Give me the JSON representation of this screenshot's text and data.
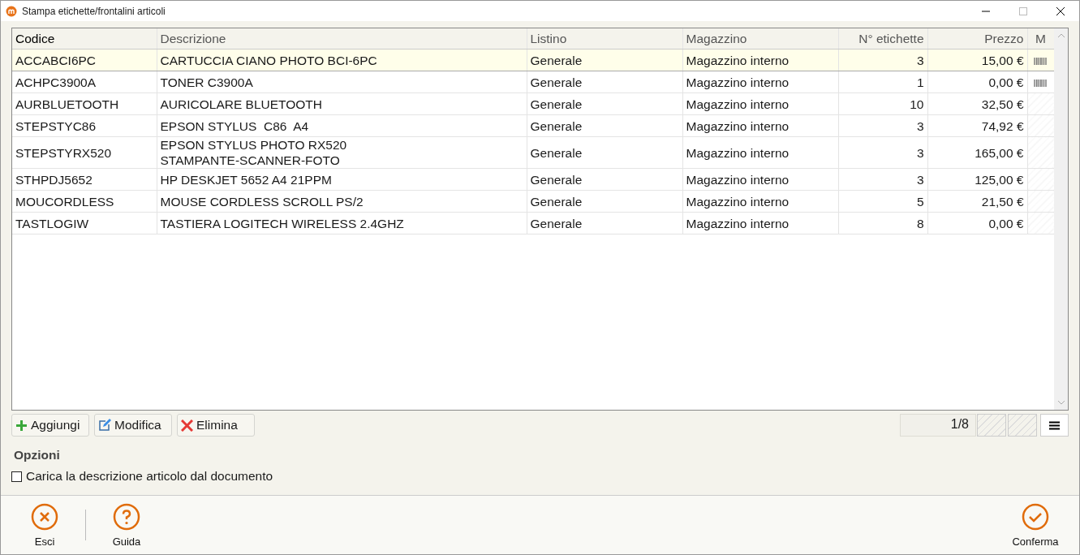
{
  "window": {
    "title": "Stampa etichette/frontalini articoli"
  },
  "table": {
    "columns": [
      {
        "label": "Codice",
        "sorted": true
      },
      {
        "label": "Descrizione",
        "sorted": false
      },
      {
        "label": "Listino",
        "sorted": false
      },
      {
        "label": "Magazzino",
        "sorted": false
      },
      {
        "label": "N° etichette",
        "sorted": false
      },
      {
        "label": "Prezzo",
        "sorted": false
      },
      {
        "label": "M",
        "sorted": false
      }
    ],
    "rows": [
      {
        "selected": true,
        "barcode": true,
        "cells": [
          "ACCABCI6PC",
          "CARTUCCIA CIANO PHOTO BCI-6PC",
          "Generale",
          "Magazzino interno",
          "3",
          "15,00 €"
        ]
      },
      {
        "selected": false,
        "barcode": true,
        "cells": [
          "ACHPC3900A",
          "TONER C3900A",
          "Generale",
          "Magazzino interno",
          "1",
          "0,00 €"
        ]
      },
      {
        "selected": false,
        "barcode": false,
        "cells": [
          "AURBLUETOOTH",
          "AURICOLARE BLUETOOTH",
          "Generale",
          "Magazzino interno",
          "10",
          "32,50 €"
        ]
      },
      {
        "selected": false,
        "barcode": false,
        "cells": [
          "STEPSTYC86",
          "EPSON STYLUS  C86  A4",
          "Generale",
          "Magazzino interno",
          "3",
          "74,92 €"
        ]
      },
      {
        "selected": false,
        "barcode": false,
        "cells": [
          "STEPSTYRX520",
          "EPSON STYLUS PHOTO RX520\nSTAMPANTE-SCANNER-FOTO",
          "Generale",
          "Magazzino interno",
          "3",
          "165,00 €"
        ]
      },
      {
        "selected": false,
        "barcode": false,
        "cells": [
          "STHPDJ5652",
          "HP DESKJET 5652 A4 21PPM",
          "Generale",
          "Magazzino interno",
          "3",
          "125,00 €"
        ]
      },
      {
        "selected": false,
        "barcode": false,
        "cells": [
          "MOUCORDLESS",
          "MOUSE CORDLESS SCROLL PS/2",
          "Generale",
          "Magazzino interno",
          "5",
          "21,50 €"
        ]
      },
      {
        "selected": false,
        "barcode": false,
        "cells": [
          "TASTLOGIW",
          "TASTIERA LOGITECH WIRELESS 2.4GHZ",
          "Generale",
          "Magazzino interno",
          "8",
          "0,00 €"
        ]
      }
    ]
  },
  "toolbar": [
    {
      "kind": "add",
      "label": "Aggiungi"
    },
    {
      "kind": "edit",
      "label": "Modifica"
    },
    {
      "kind": "delete",
      "label": "Elimina"
    }
  ],
  "pager": {
    "position": "1/8"
  },
  "options": {
    "title": "Opzioni",
    "items": [
      {
        "label": "Carica la descrizione articolo dal documento",
        "checked": false
      }
    ]
  },
  "footer": [
    {
      "kind": "close",
      "label": "Esci"
    },
    {
      "kind": "help",
      "label": "Guida"
    },
    {
      "kind": "confirm",
      "label": "Conferma"
    }
  ]
}
